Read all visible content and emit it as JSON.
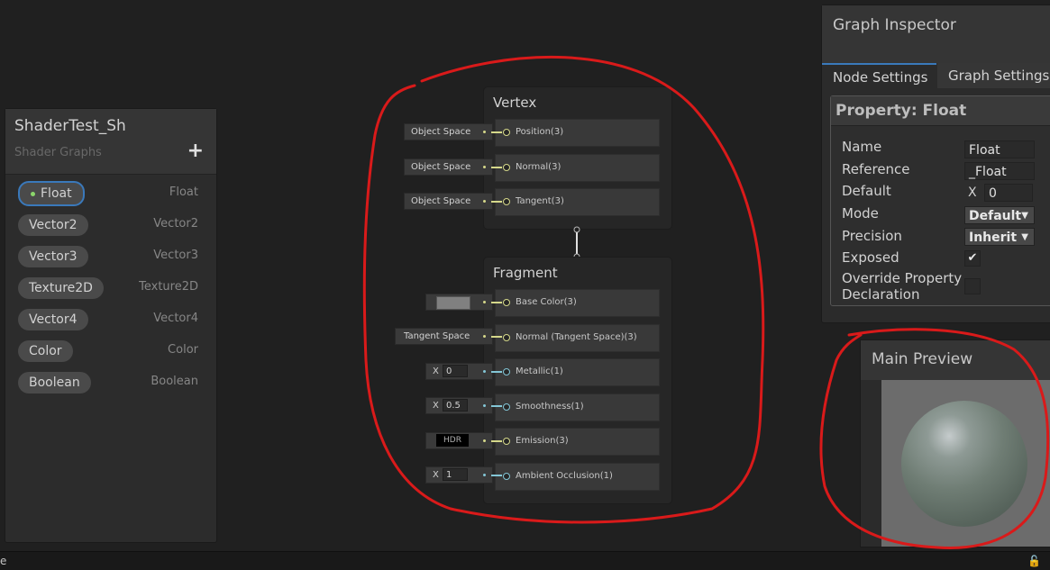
{
  "blackboard": {
    "title": "ShaderTest_Sh",
    "subtitle": "Shader Graphs",
    "add_label": "+",
    "properties": [
      {
        "name": "Float",
        "type": "Float"
      },
      {
        "name": "Vector2",
        "type": "Vector2"
      },
      {
        "name": "Vector3",
        "type": "Vector3"
      },
      {
        "name": "Texture2D",
        "type": "Texture2D"
      },
      {
        "name": "Vector4",
        "type": "Vector4"
      },
      {
        "name": "Color",
        "type": "Color"
      },
      {
        "name": "Boolean",
        "type": "Boolean"
      }
    ]
  },
  "vertex": {
    "title": "Vertex",
    "slots": [
      {
        "label": "Position(3)",
        "input": "Object Space"
      },
      {
        "label": "Normal(3)",
        "input": "Object Space"
      },
      {
        "label": "Tangent(3)",
        "input": "Object Space"
      }
    ]
  },
  "fragment": {
    "title": "Fragment",
    "slots": [
      {
        "label": "Base Color(3)",
        "input": ""
      },
      {
        "label": "Normal (Tangent Space)(3)",
        "input": "Tangent Space"
      },
      {
        "label": "Metallic(1)",
        "x_label": "X",
        "value": "0"
      },
      {
        "label": "Smoothness(1)",
        "x_label": "X",
        "value": "0.5"
      },
      {
        "label": "Emission(3)",
        "input": "HDR"
      },
      {
        "label": "Ambient Occlusion(1)",
        "x_label": "X",
        "value": "1"
      }
    ],
    "base_color": "#808080"
  },
  "inspector": {
    "title": "Graph Inspector",
    "tabs": [
      "Node Settings",
      "Graph Settings"
    ],
    "property_title": "Property: Float",
    "fields": {
      "name_label": "Name",
      "name_value": "Float",
      "reference_label": "Reference",
      "reference_value": "_Float",
      "default_label": "Default",
      "default_x": "X",
      "default_value": "0",
      "mode_label": "Mode",
      "mode_value": "Default",
      "precision_label": "Precision",
      "precision_value": "Inherit",
      "exposed_label": "Exposed",
      "exposed_mark": "✔",
      "override_label_1": "Override Property",
      "override_label_2": "Declaration"
    }
  },
  "preview": {
    "title": "Main Preview"
  },
  "statusbar": {
    "text": "e",
    "lock": "🔓"
  },
  "colors": {
    "accent": "#3a79bb",
    "port_yellow": "#d5d88a",
    "port_blue": "#83c6d6",
    "annotation_red": "#d91a1a"
  }
}
